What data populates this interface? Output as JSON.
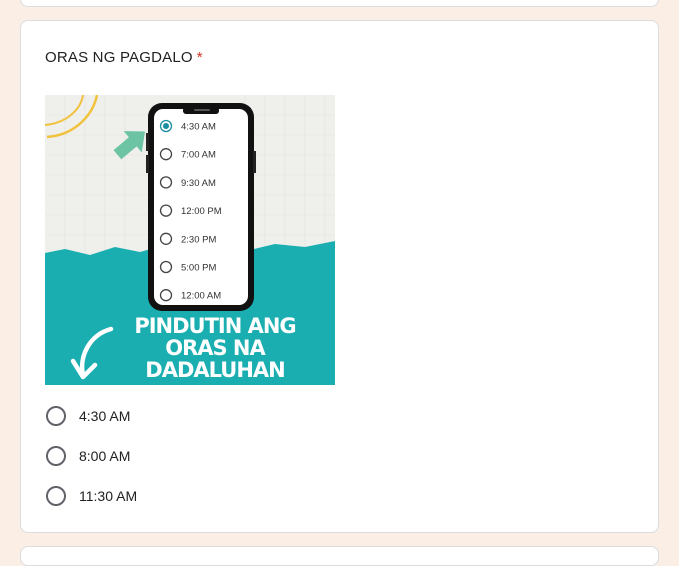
{
  "question": {
    "title": "ORAS NG PAGDALO",
    "required_mark": "*",
    "image": {
      "phone_options": [
        "4:30 AM",
        "7:00 AM",
        "9:30 AM",
        "12:00 PM",
        "2:30 PM",
        "5:00 PM",
        "12:00 AM"
      ],
      "selected_index": 0,
      "banner_lines": [
        "PINDUTIN ANG",
        "ORAS NA",
        "DADALUHAN"
      ]
    },
    "options": [
      {
        "label": "4:30 AM"
      },
      {
        "label": "8:00 AM"
      },
      {
        "label": "11:30 AM"
      }
    ]
  },
  "colors": {
    "teal": "#1aaeb0",
    "accent_radio": "#1a8fa0",
    "required": "#d93025",
    "page_bg": "#fbeee4"
  }
}
